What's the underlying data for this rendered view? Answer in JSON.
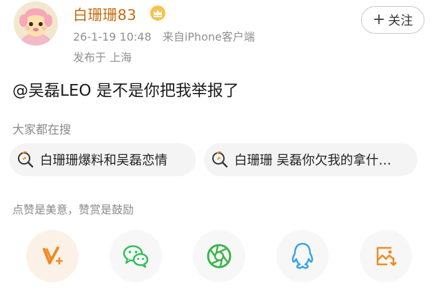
{
  "user": {
    "name": "白珊珊83",
    "date": "26-1-19 10:48",
    "source": "来自iPhone客户端",
    "location": "发布于 上海"
  },
  "follow_button": {
    "plus": "+",
    "label": "关注"
  },
  "post": {
    "mention": "@吴磊LEO",
    "text": " 是不是你把我举报了"
  },
  "trending": {
    "title": "大家都在搜",
    "items": [
      {
        "label": "白珊珊爆料和吴磊恋情",
        "icon": "hot-search-icon"
      },
      {
        "label": "白珊珊 吴磊你欠我的拿什…",
        "icon": "hot-search-icon"
      }
    ]
  },
  "reward_text": "点赞是美意，赞赏是鼓励",
  "share": {
    "items": [
      {
        "icon": "v-plus-icon"
      },
      {
        "icon": "wechat-icon"
      },
      {
        "icon": "moments-icon"
      },
      {
        "icon": "qq-icon"
      },
      {
        "icon": "save-image-icon"
      }
    ]
  },
  "colors": {
    "username": "#c56a0c",
    "secondary_text": "#8f8f8f",
    "chip_bg": "#f4f4f4",
    "wechat_green": "#2dbf57",
    "moments_green": "#39b54a",
    "qq_blue": "#3aa0e8",
    "orange": "#f08a24"
  }
}
